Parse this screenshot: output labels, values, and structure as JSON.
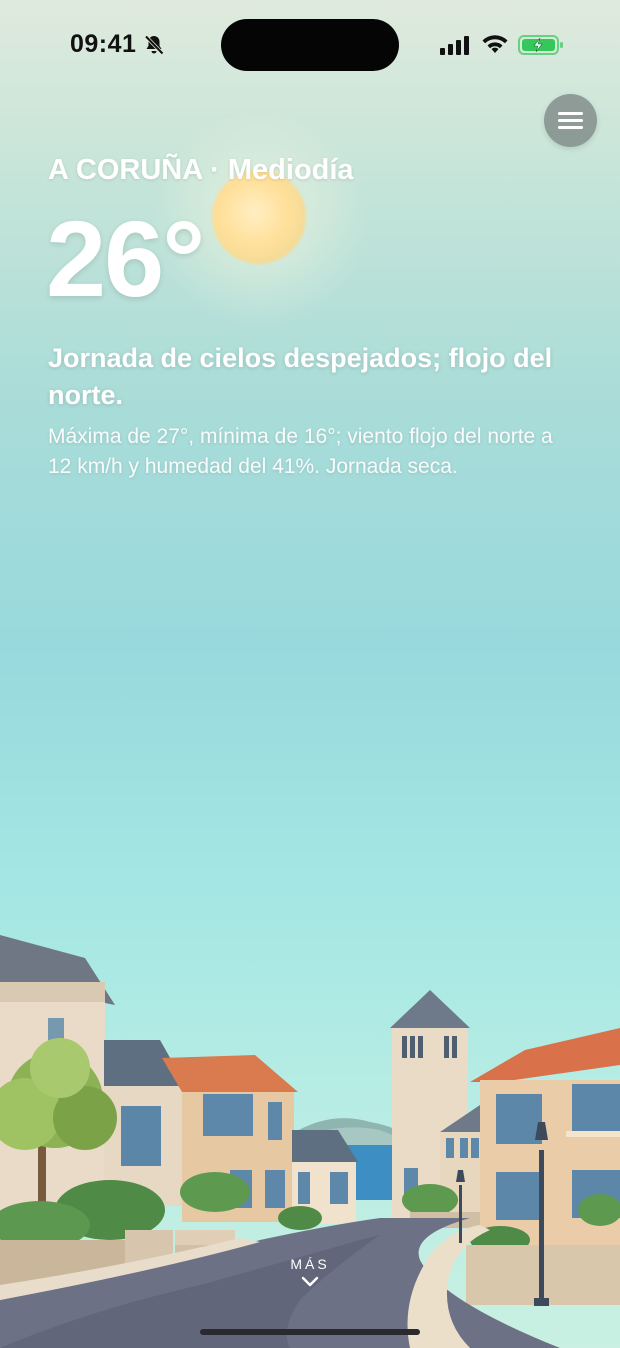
{
  "status_bar": {
    "time": "09:41",
    "icons": [
      "bell-slash-icon",
      "signal-icon",
      "wifi-icon",
      "battery-charging-icon"
    ],
    "battery_color": "#34c759"
  },
  "menu": {
    "icon": "hamburger-menu-icon"
  },
  "weather": {
    "location": "A CORUÑA · Mediodía",
    "temperature": "26°",
    "headline": "Jornada de cielos despejados; flojo del norte.",
    "detail": "Máxima de 27°, mínima de 16°; viento flojo del norte a 12 km/h y humedad del 41%. Jornada seca."
  },
  "footer": {
    "more_label": "MÁS",
    "more_icon": "chevron-down-icon"
  },
  "colors": {
    "sky_top": "#dfeadd",
    "sky_mid": "#98d9dd",
    "sky_bottom": "#c9f0e2",
    "sun": "#ffe09a"
  }
}
